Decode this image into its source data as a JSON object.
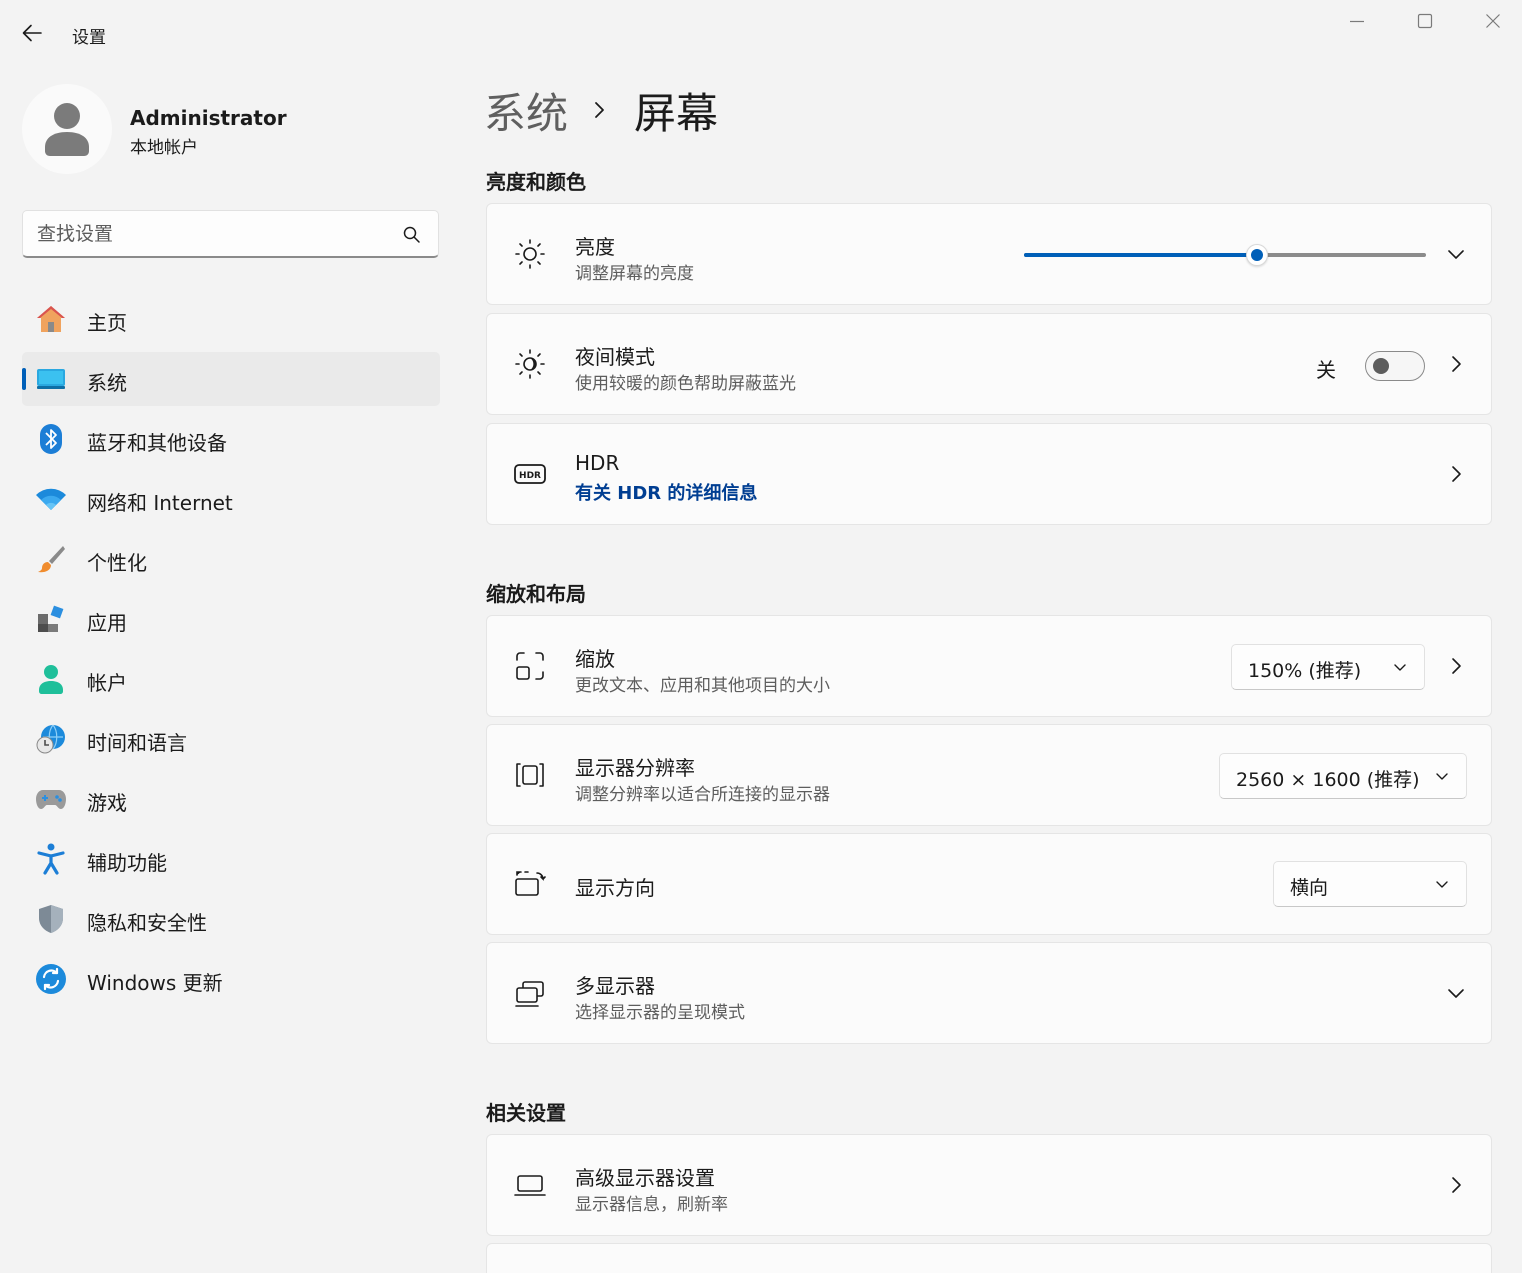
{
  "window": {
    "app_title": "设置"
  },
  "account": {
    "name": "Administrator",
    "type": "本地帐户"
  },
  "search": {
    "placeholder": "查找设置"
  },
  "nav": {
    "items": [
      {
        "label": "主页",
        "icon": "home-icon"
      },
      {
        "label": "系统",
        "icon": "system-icon",
        "active": true
      },
      {
        "label": "蓝牙和其他设备",
        "icon": "bluetooth-icon"
      },
      {
        "label": "网络和 Internet",
        "icon": "wifi-icon"
      },
      {
        "label": "个性化",
        "icon": "brush-icon"
      },
      {
        "label": "应用",
        "icon": "apps-icon"
      },
      {
        "label": "帐户",
        "icon": "account-icon"
      },
      {
        "label": "时间和语言",
        "icon": "time-language-icon"
      },
      {
        "label": "游戏",
        "icon": "gamepad-icon"
      },
      {
        "label": "辅助功能",
        "icon": "accessibility-icon"
      },
      {
        "label": "隐私和安全性",
        "icon": "shield-icon"
      },
      {
        "label": "Windows 更新",
        "icon": "update-icon"
      }
    ]
  },
  "breadcrumb": {
    "parent": "系统",
    "current": "屏幕"
  },
  "sections": {
    "brightness_color": "亮度和颜色",
    "scale_layout": "缩放和布局",
    "related": "相关设置"
  },
  "cards": {
    "brightness": {
      "title": "亮度",
      "subtitle": "调整屏幕的亮度",
      "value": 58
    },
    "night_light": {
      "title": "夜间模式",
      "subtitle": "使用较暖的颜色帮助屏蔽蓝光",
      "state_label": "关",
      "on": false
    },
    "hdr": {
      "title": "HDR",
      "link": "有关 HDR 的详细信息"
    },
    "scale": {
      "title": "缩放",
      "subtitle": "更改文本、应用和其他项目的大小",
      "selected": "150% (推荐)"
    },
    "resolution": {
      "title": "显示器分辨率",
      "subtitle": "调整分辨率以适合所连接的显示器",
      "selected": "2560 × 1600 (推荐)"
    },
    "orientation": {
      "title": "显示方向",
      "selected": "横向"
    },
    "multi_display": {
      "title": "多显示器",
      "subtitle": "选择显示器的呈现模式"
    },
    "advanced_display": {
      "title": "高级显示器设置",
      "subtitle": "显示器信息，刷新率"
    }
  },
  "colors": {
    "accent": "#005fb8",
    "link": "#003e92",
    "background": "#f3f3f3",
    "card": "#fbfbfb"
  }
}
